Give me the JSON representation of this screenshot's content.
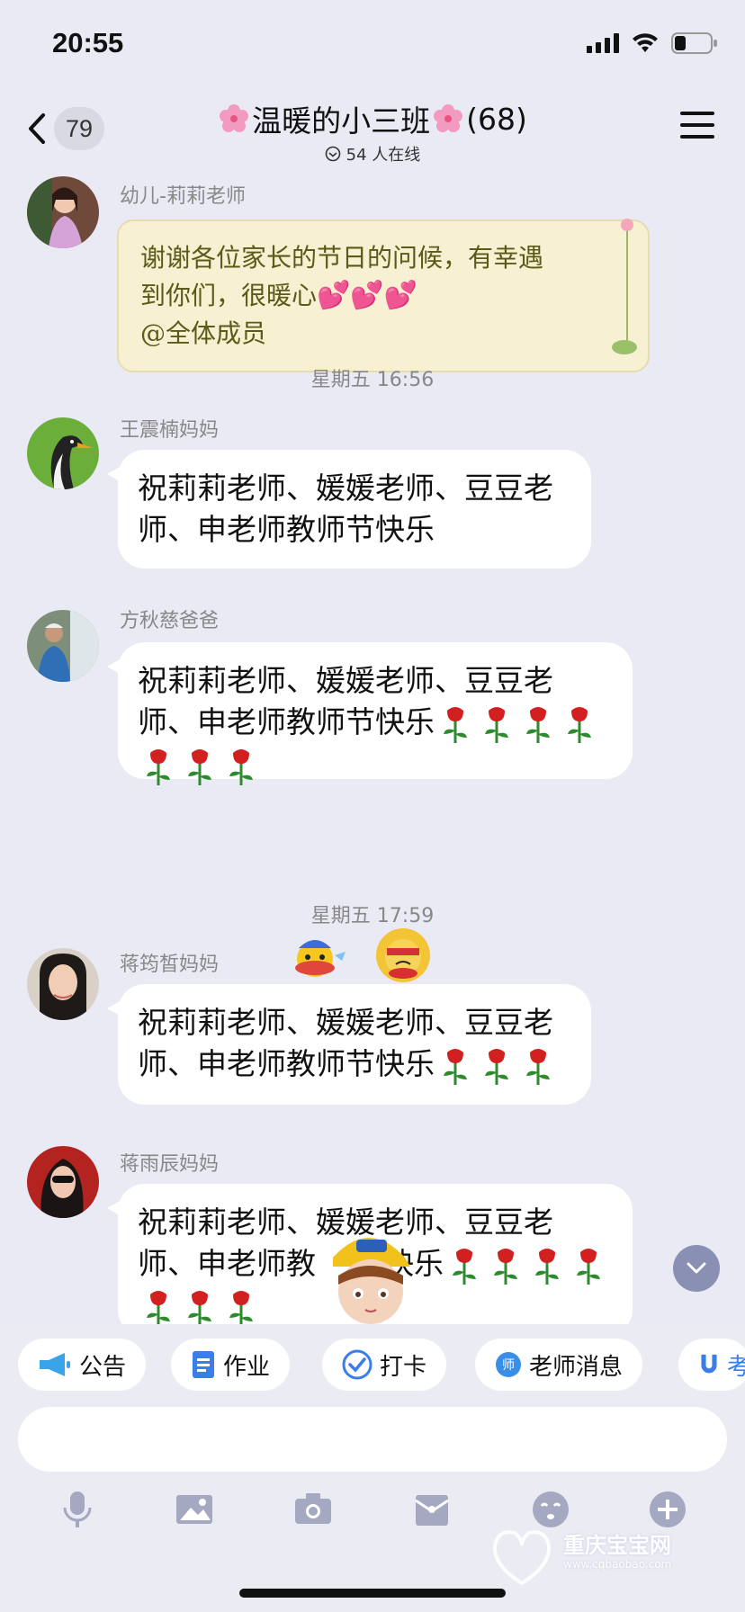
{
  "status": {
    "time": "20:55"
  },
  "header": {
    "back_count": "79",
    "title": "温暖的小三班",
    "member_count": "(68)",
    "online": "54 人在线"
  },
  "messages": [
    {
      "sender": "幼儿-莉莉老师",
      "line1": "谢谢各位家长的节日的问候，有幸遇",
      "line2": "到你们，很暖心",
      "line3": "@全体成员"
    },
    {
      "timestamp": "星期五 16:56"
    },
    {
      "sender": "王震楠妈妈",
      "line1": "祝莉莉老师、媛媛老师、豆豆老",
      "line2": "师、申老师教师节快乐"
    },
    {
      "sender": "方秋慈爸爸",
      "line1": "祝莉莉老师、媛媛老师、豆豆老",
      "line2": "师、申老师教师节快乐"
    },
    {
      "timestamp": "星期五 17:59"
    },
    {
      "sender": "蒋筠皙妈妈",
      "line1": "祝莉莉老师、媛媛老师、豆豆老",
      "line2": "师、申老师教师节快乐"
    },
    {
      "sender": "蒋雨辰妈妈",
      "line1": "祝莉莉老师、媛媛老师、豆豆老",
      "line2": "师、申老师教",
      "line2b": "快乐"
    }
  ],
  "quickbar": [
    {
      "label": "公告",
      "icon": "megaphone-icon"
    },
    {
      "label": "作业",
      "icon": "document-icon"
    },
    {
      "label": "打卡",
      "icon": "checkin-icon"
    },
    {
      "label": "老师消息",
      "icon": "teacher-icon"
    },
    {
      "label": "考",
      "icon": "magnet-icon"
    }
  ],
  "toolbar": [
    "microphone-icon",
    "image-icon",
    "camera-icon",
    "file-icon",
    "emoji-icon",
    "plus-icon"
  ],
  "watermark": {
    "name": "重庆宝宝网",
    "url": "www.cqbaobao.com"
  },
  "colors": {
    "background": "#eaeaf5",
    "bubble": "#ffffff",
    "accent": "#3b7ddd",
    "rose": "#d21f1f"
  }
}
